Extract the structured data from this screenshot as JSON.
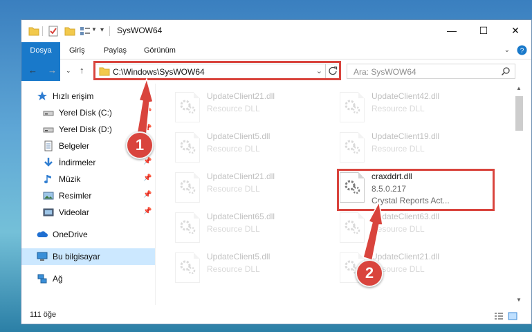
{
  "window": {
    "title": "SysWOW64",
    "controls": {
      "minimize": "—",
      "maximize": "☐",
      "close": "✕"
    }
  },
  "ribbon": {
    "tabs": [
      {
        "label": "Dosya"
      },
      {
        "label": "Giriş"
      },
      {
        "label": "Paylaş"
      },
      {
        "label": "Görünüm"
      }
    ]
  },
  "navigation": {
    "address": "C:\\Windows\\SysWOW64",
    "search_placeholder": "Ara: SysWOW64"
  },
  "sidebar": {
    "items": [
      {
        "label": "Hızlı erişim",
        "icon": "star-icon"
      },
      {
        "label": "Yerel Disk (C:)",
        "icon": "drive-icon"
      },
      {
        "label": "Yerel Disk (D:)",
        "icon": "drive-icon"
      },
      {
        "label": "Belgeler",
        "icon": "documents-icon"
      },
      {
        "label": "İndirmeler",
        "icon": "download-icon"
      },
      {
        "label": "Müzik",
        "icon": "music-icon"
      },
      {
        "label": "Resimler",
        "icon": "pictures-icon"
      },
      {
        "label": "Videolar",
        "icon": "videos-icon"
      },
      {
        "label": "OneDrive",
        "icon": "cloud-icon"
      },
      {
        "label": "Bu bilgisayar",
        "icon": "computer-icon"
      },
      {
        "label": "Ağ",
        "icon": "network-icon"
      }
    ]
  },
  "files": [
    {
      "name": "UpdateClient21.dll",
      "desc": "Resource DLL"
    },
    {
      "name": "UpdateClient42.dll",
      "desc": "Resource DLL"
    },
    {
      "name": "UpdateClient5.dll",
      "desc": "Resource DLL"
    },
    {
      "name": "UpdateClient19.dll",
      "desc": "Resource DLL"
    },
    {
      "name": "UpdateClient21.dll",
      "desc": "Resource DLL"
    },
    {
      "name": "craxddrt.dll",
      "version": "8.5.0.217",
      "desc": "Crystal Reports Act..."
    },
    {
      "name": "UpdateClient65.dll",
      "desc": "Resource DLL"
    },
    {
      "name": "UpdateClient63.dll",
      "desc": "Resource DLL"
    },
    {
      "name": "UpdateClient5.dll",
      "desc": "Resource DLL"
    },
    {
      "name": "UpdateClient21.dll",
      "desc": "Resource DLL"
    }
  ],
  "status": {
    "count": "111 öğe"
  },
  "annotations": {
    "step1": "1",
    "step2": "2"
  },
  "colors": {
    "accent": "#1979ca",
    "highlight": "#d9443d",
    "selected": "#cce8ff"
  }
}
